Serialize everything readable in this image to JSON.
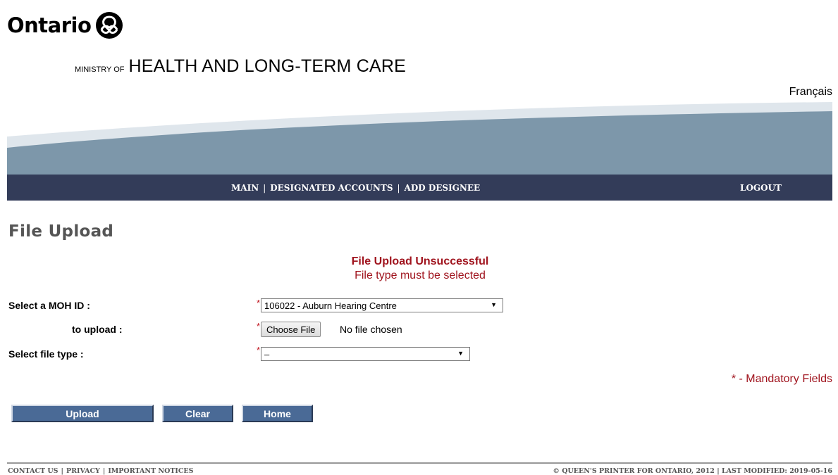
{
  "header": {
    "logo_text": "Ontario",
    "ministry_prefix": "MINISTRY OF",
    "ministry_name": "HEALTH AND LONG-TERM CARE",
    "language_link": "Français"
  },
  "nav": {
    "items": [
      "MAIN",
      "DESIGNATED ACCOUNTS",
      "ADD DESIGNEE"
    ],
    "separator": "|",
    "logout": "LOGOUT"
  },
  "page": {
    "title": "File Upload",
    "message_title": "File Upload Unsuccessful",
    "message_detail": "File type must be selected"
  },
  "form": {
    "moh_label": "Select a MOH ID :",
    "moh_value": "106022 - Auburn Hearing Centre",
    "upload_label": "to upload :",
    "choose_file": "Choose File",
    "no_file": "No file chosen",
    "filetype_label": "Select file type :",
    "filetype_value": "–",
    "required_marker": "*",
    "mandatory_note": "* - Mandatory Fields"
  },
  "buttons": {
    "upload": "Upload",
    "clear": "Clear",
    "home": "Home"
  },
  "footer": {
    "links": [
      "CONTACT US",
      "PRIVACY",
      "IMPORTANT NOTICES"
    ],
    "separator": "|",
    "copyright": "© QUEEN'S PRINTER FOR ONTARIO, 2012 | LAST MODIFIED: 2019-05-16"
  },
  "colors": {
    "nav_bg": "#333c59",
    "error_red": "#a0141e",
    "button_blue": "#4a6a96",
    "swoosh_blue": "#7d97aa"
  },
  "icons": {
    "logo": "ontario-trillium-icon",
    "dropdown": "chevron-down-icon"
  }
}
